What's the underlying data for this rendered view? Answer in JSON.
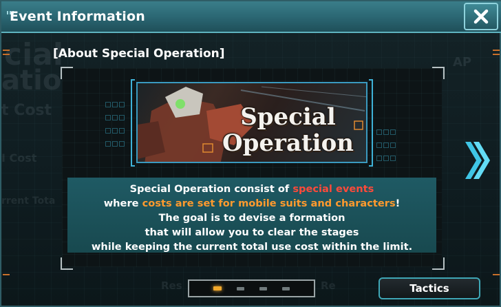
{
  "window": {
    "title": "Event Information",
    "close_icon": "close-x-icon"
  },
  "background": {
    "ghost_texts": [
      "cial",
      "atio",
      "t Cost",
      "I Cost",
      "rrent Tota",
      "Res",
      "Re",
      "AP"
    ]
  },
  "content": {
    "subtitle": "[About Special Operation]",
    "banner": {
      "line1": "Special",
      "line2": "Operation"
    },
    "description": {
      "line1_a": "Special Operation consist of ",
      "line1_hl": "special events",
      "line2_a": "where ",
      "line2_hl": "costs are set for mobile suits and characters",
      "line2_b": "!",
      "line3": "The goal is to devise a formation",
      "line4": "that will allow you to clear the stages",
      "line5": "while keeping the current total use cost within the limit."
    }
  },
  "pager": {
    "total_pages": 4,
    "current_page": 1
  },
  "buttons": {
    "tactics_label": "Tactics",
    "next_icon": "double-chevron-right-icon"
  },
  "colors": {
    "accent": "#3fa7b6",
    "highlight_red": "#ff4a3a",
    "highlight_orange": "#ff9a2e",
    "active_dot": "#f2a92b"
  }
}
